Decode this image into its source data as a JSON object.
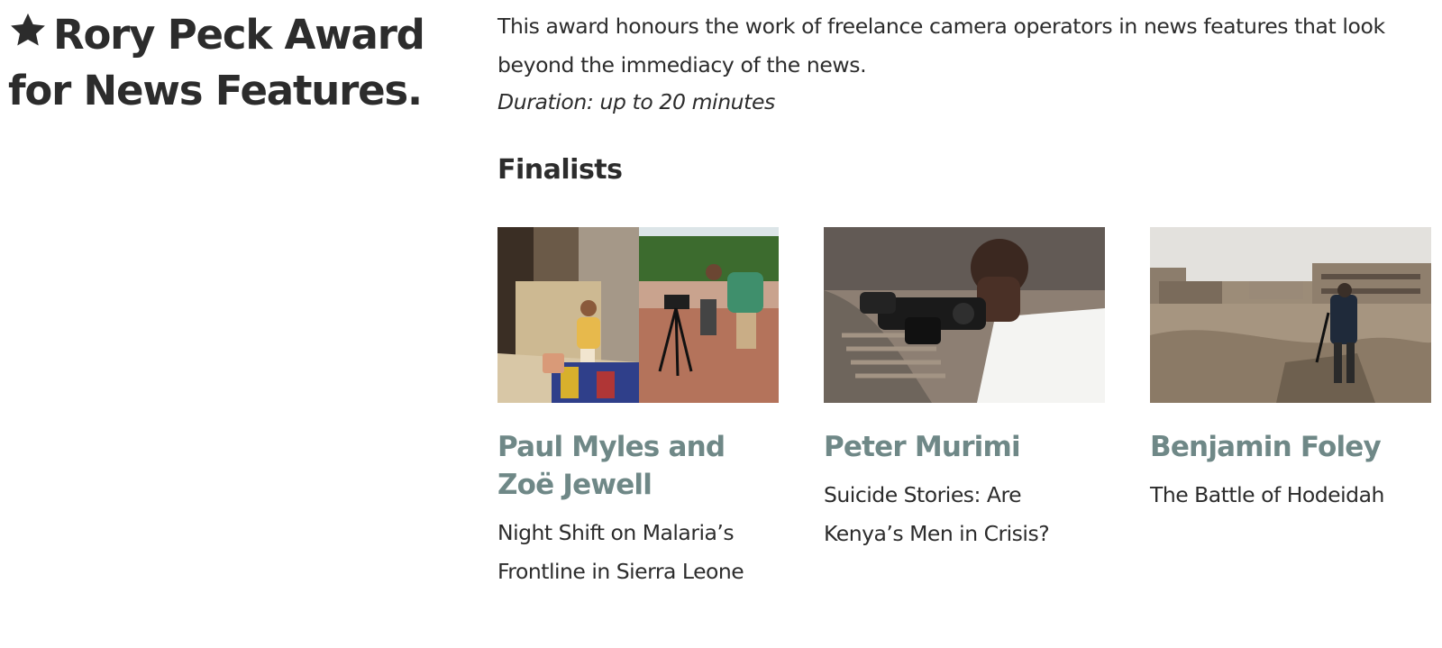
{
  "award": {
    "title": "Rory Peck Award for News Features.",
    "description": "This award honours the work of freelance camera operators in news features that look beyond the immediacy of the news.",
    "duration": "Duration: up to 20 minutes"
  },
  "finalists_heading": "Finalists",
  "finalists": [
    {
      "name": "Paul Myles and Zoë Jewell",
      "film": "Night Shift on Malaria’s Frontline in Sierra Leone"
    },
    {
      "name": "Peter Murimi",
      "film": "Suicide Stories: Are Kenya’s Men in Crisis?"
    },
    {
      "name": "Benjamin Foley",
      "film": "The Battle of Hodeidah"
    }
  ],
  "colors": {
    "text": "#2c2c2c",
    "finalist_name": "#6f8887",
    "background": "#ffffff"
  },
  "icons": {
    "title_icon": "star-icon"
  }
}
